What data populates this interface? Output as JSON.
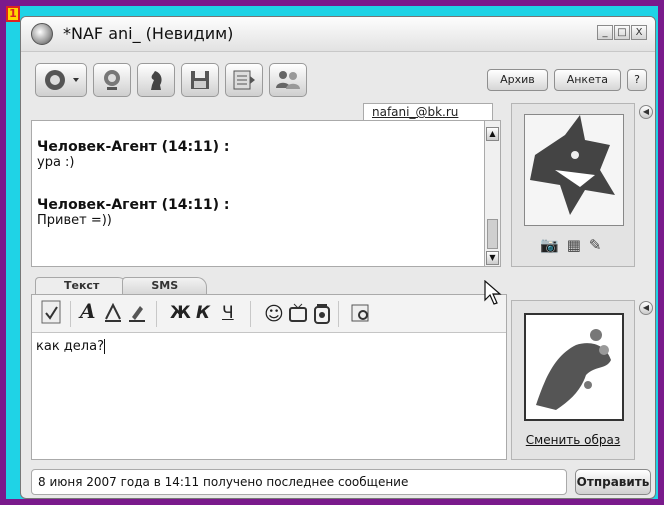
{
  "badge": {
    "label": "1"
  },
  "window": {
    "title": "*NAF ani_ (Невидим)"
  },
  "window_controls": {
    "minimize": "_",
    "restore": "□",
    "close": "X"
  },
  "toolbar": {
    "icons": [
      "status-icon",
      "webcam-icon",
      "chess-icon",
      "save-icon",
      "history-icon",
      "contacts-icon"
    ],
    "archive_label": "Архив",
    "profile_label": "Анкета",
    "help_label": "?"
  },
  "contact": {
    "email": "nafani_@bk.ru"
  },
  "chat": {
    "messages": [
      {
        "header": "Человек-Агент (14:11) :",
        "text": "ура :)"
      },
      {
        "header": "Человек-Агент (14:11) :",
        "text": "Привет =))"
      }
    ]
  },
  "tabs": {
    "text_label": "Текст",
    "sms_label": "SMS"
  },
  "formatting": {
    "bold": "Ж",
    "italic": "К",
    "underline": "Ч"
  },
  "compose": {
    "text": "как дела?"
  },
  "my_avatar": {
    "change_label": "Сменить образ"
  },
  "status": {
    "text": "8 июня 2007 года в 14:11 получено последнее сообщение"
  },
  "send": {
    "label": "Отправить"
  }
}
